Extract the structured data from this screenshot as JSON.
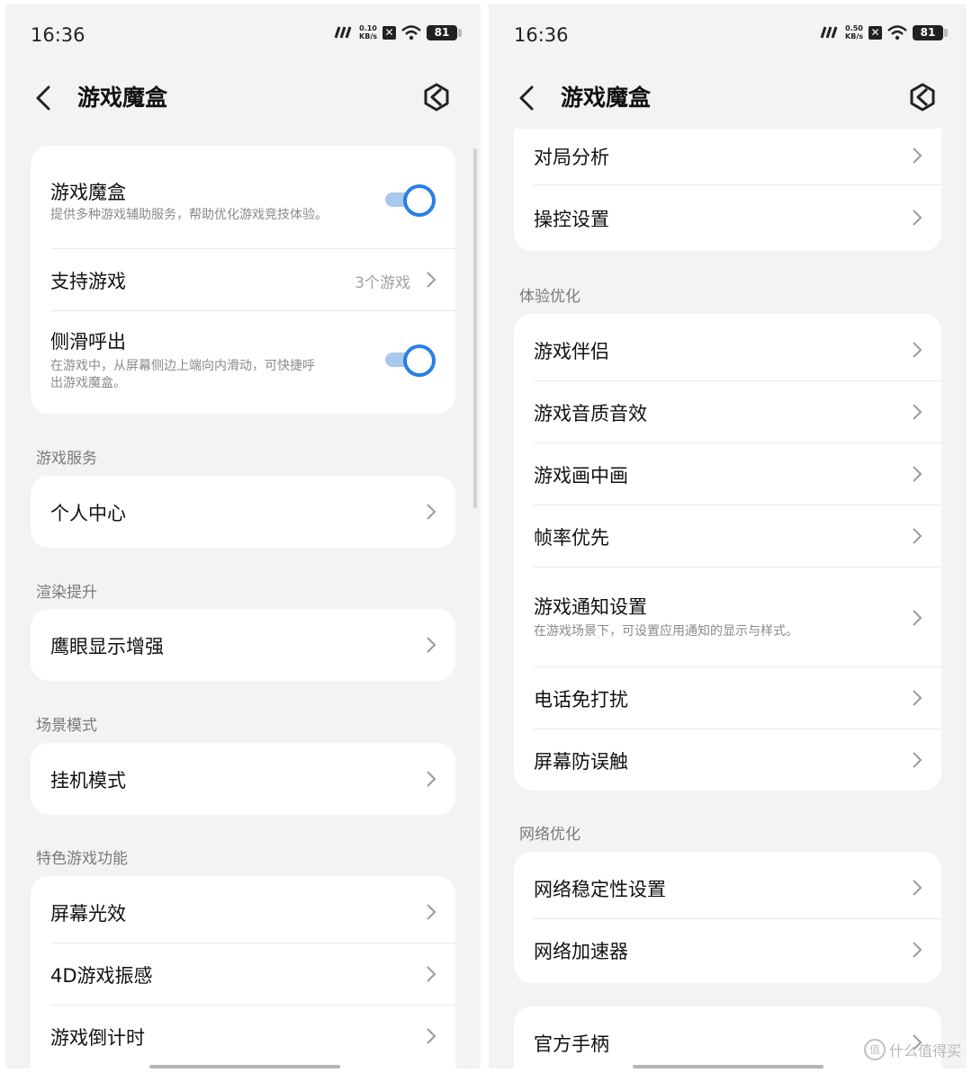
{
  "left": {
    "status": {
      "time": "16:36",
      "net_value": "0.10",
      "net_unit": "KB/s",
      "battery": "81"
    },
    "header": {
      "title": "游戏魔盒"
    },
    "card_main": {
      "game_box": {
        "title": "游戏魔盒",
        "subtitle": "提供多种游戏辅助服务，帮助优化游戏竞技体验。",
        "enabled": true
      },
      "supported_games": {
        "title": "支持游戏",
        "value": "3个游戏"
      },
      "swipe_call": {
        "title": "侧滑呼出",
        "subtitle_1": "在游戏中，从屏幕侧边上端向内滑动，可快捷呼",
        "subtitle_2": "出游戏魔盒。",
        "enabled": true
      }
    },
    "sections": {
      "game_service": {
        "label": "游戏服务",
        "items": [
          "个人中心"
        ]
      },
      "render_boost": {
        "label": "渲染提升",
        "items": [
          "鹰眼显示增强"
        ]
      },
      "scene_mode": {
        "label": "场景模式",
        "items": [
          "挂机模式"
        ]
      },
      "special": {
        "label": "特色游戏功能",
        "items": [
          "屏幕光效",
          "4D游戏振感",
          "游戏倒计时"
        ]
      }
    }
  },
  "right": {
    "status": {
      "time": "16:36",
      "net_value": "0.50",
      "net_unit": "KB/s",
      "battery": "81"
    },
    "header": {
      "title": "游戏魔盒"
    },
    "top_card": {
      "items": [
        "对局分析",
        "操控设置"
      ]
    },
    "experience": {
      "label": "体验优化",
      "items": [
        "游戏伴侣",
        "游戏音质音效",
        "游戏画中画",
        "帧率优先"
      ],
      "notify": {
        "title": "游戏通知设置",
        "subtitle": "在游戏场景下，可设置应用通知的显示与样式。"
      },
      "items2": [
        "电话免打扰",
        "屏幕防误触"
      ]
    },
    "network": {
      "label": "网络优化",
      "items": [
        "网络稳定性设置",
        "网络加速器"
      ]
    },
    "bottom_card": {
      "items": [
        "官方手柄"
      ]
    }
  },
  "watermark": {
    "text": "什么值得买",
    "icon_glyph": "值"
  },
  "colors": {
    "accent": "#2a7fe6",
    "track": "#a8c8f0",
    "background": "#f2f3f5",
    "card": "#ffffff"
  }
}
